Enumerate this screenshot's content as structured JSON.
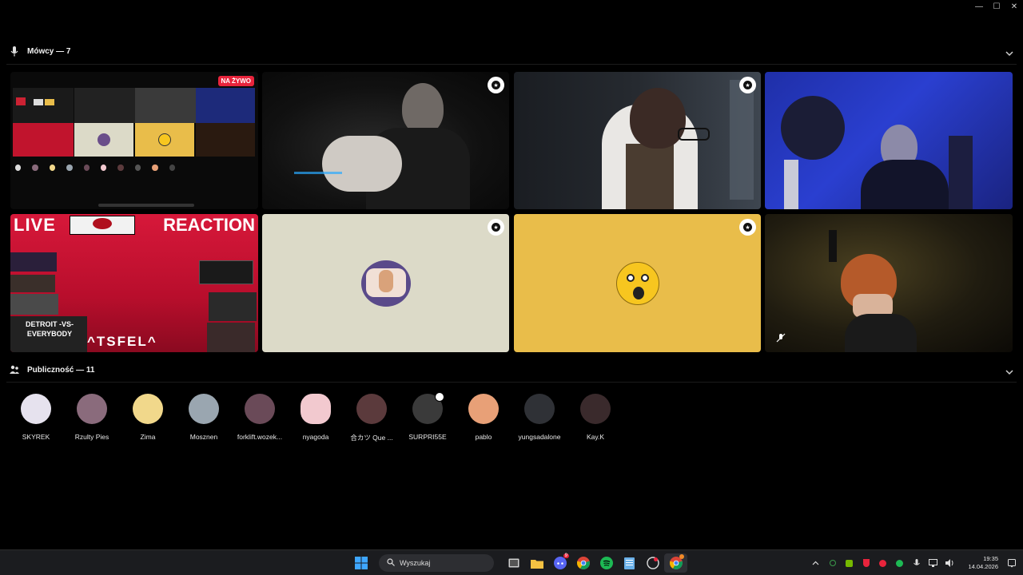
{
  "window": {
    "minimize": "—",
    "maximize": "☐",
    "close": "✕"
  },
  "speakers": {
    "title": "Mówcy — 7",
    "icon": "microphone-icon",
    "tiles": [
      {
        "name": "screen-share-tile",
        "live_badge": "NA ŻYWO"
      },
      {
        "name": "speaker-tile-2",
        "moderator": true
      },
      {
        "name": "speaker-tile-3",
        "moderator": true
      },
      {
        "name": "speaker-tile-4",
        "moderator": false
      },
      {
        "name": "stream-tile",
        "overlay_left": "LIVE",
        "overlay_right": "REACTION",
        "overlay_bottom": "^TSFEL^",
        "sign_text": "DETROIT -VS- EVERYBODY"
      },
      {
        "name": "avatar-tile-6",
        "moderator": true,
        "bg": "#dcdac8"
      },
      {
        "name": "avatar-tile-7",
        "moderator": true,
        "bg": "#e9bd4a"
      },
      {
        "name": "speaker-tile-8",
        "moderator": false
      }
    ]
  },
  "audience": {
    "title": "Publiczność — 11",
    "icon": "people-icon",
    "members": [
      {
        "name": "SKYREK",
        "color": "#e6e2ee"
      },
      {
        "name": "Rzulty Pies",
        "color": "#8a6b7c"
      },
      {
        "name": "Zima",
        "color": "#f1d88b"
      },
      {
        "name": "Mosznen",
        "color": "#9aa6b0"
      },
      {
        "name": "forklift.wozek...",
        "color": "#6a4a58"
      },
      {
        "name": "nyagoda",
        "color": "#f2c9cf"
      },
      {
        "name": "合カツ Que ...",
        "color": "#5b3a3c"
      },
      {
        "name": "SURPRI55E",
        "color": "#3a3a3a",
        "moderator": true
      },
      {
        "name": "pablo",
        "color": "#e8a077"
      },
      {
        "name": "yungsadalone",
        "color": "#2f3136"
      },
      {
        "name": "Kay.K",
        "color": "#3a2a2c"
      }
    ]
  },
  "taskbar": {
    "search_placeholder": "Wyszukaj",
    "discord_badge": "9",
    "time": "19:35",
    "date": "14.04.2026"
  }
}
